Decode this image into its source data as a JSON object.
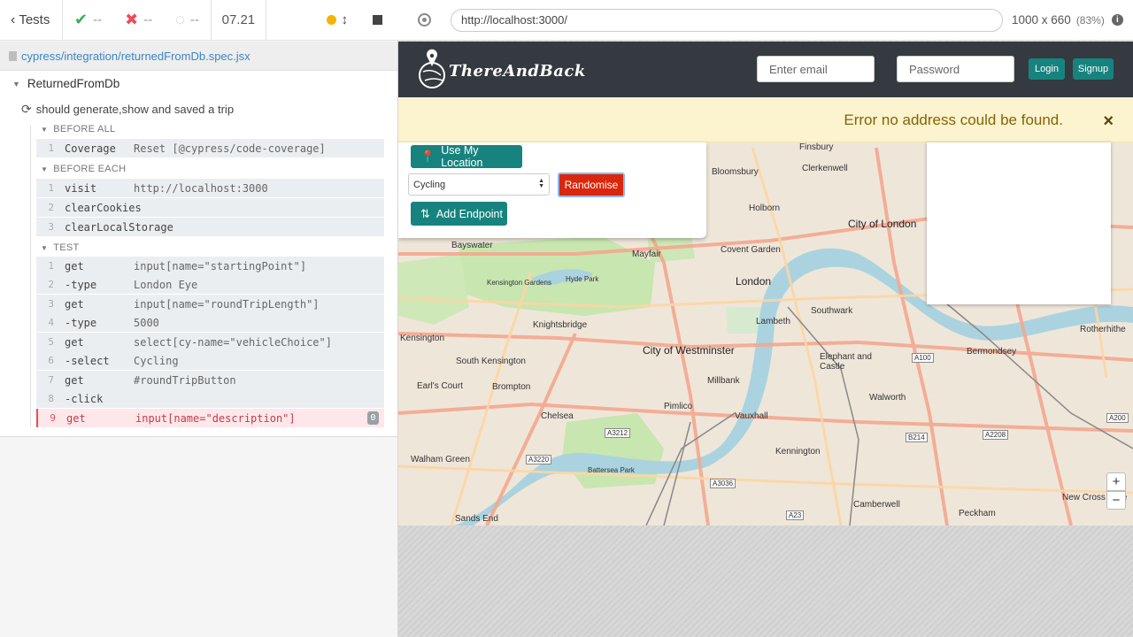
{
  "runner": {
    "tests_label": "Tests",
    "passed": "--",
    "failed": "--",
    "pending": "--",
    "timer": "07.21",
    "spec_path": "cypress/integration/returnedFromDb.spec.jsx",
    "suite_title": "ReturnedFromDb",
    "test_title": "should generate,show and saved a trip",
    "hooks": {
      "before_all": {
        "label": "BEFORE ALL",
        "commands": [
          {
            "num": "1",
            "name": "Coverage",
            "arg": "Reset [@cypress/code-coverage]"
          }
        ]
      },
      "before_each": {
        "label": "BEFORE EACH",
        "commands": [
          {
            "num": "1",
            "name": "visit",
            "arg": "http://localhost:3000"
          },
          {
            "num": "2",
            "name": "clearCookies",
            "arg": ""
          },
          {
            "num": "3",
            "name": "clearLocalStorage",
            "arg": ""
          }
        ]
      },
      "test": {
        "label": "TEST",
        "commands": [
          {
            "num": "1",
            "name": "get",
            "arg": "input[name=\"startingPoint\"]"
          },
          {
            "num": "2",
            "name": "-type",
            "arg": "London Eye"
          },
          {
            "num": "3",
            "name": "get",
            "arg": "input[name=\"roundTripLength\"]"
          },
          {
            "num": "4",
            "name": "-type",
            "arg": "5000"
          },
          {
            "num": "5",
            "name": "get",
            "arg": "select[cy-name=\"vehicleChoice\"]"
          },
          {
            "num": "6",
            "name": "-select",
            "arg": "Cycling"
          },
          {
            "num": "7",
            "name": "get",
            "arg": "#roundTripButton"
          },
          {
            "num": "8",
            "name": "-click",
            "arg": ""
          },
          {
            "num": "9",
            "name": "get",
            "arg": "input[name=\"description\"]",
            "badge": "0"
          }
        ]
      }
    }
  },
  "browser": {
    "url": "http://localhost:3000/",
    "viewport_size": "1000 x 660",
    "viewport_zoom": "(83%)"
  },
  "app": {
    "brand": "ThereAndBack",
    "email_placeholder": "Enter email",
    "password_placeholder": "Password",
    "login_label": "Login",
    "signup_label": "Signup",
    "error_message": "Error no address could be found.",
    "close_symbol": "×",
    "use_location_label": "Use My Location",
    "vehicle_selected": "Cycling",
    "randomise_label": "Randomise",
    "add_endpoint_label": "Add Endpoint",
    "zoom_in": "+",
    "zoom_out": "−"
  },
  "map": {
    "labels": [
      "Finsbury",
      "Bloomsbury",
      "Clerkenwell",
      "Holborn",
      "City of London",
      "Bayswater",
      "Mayfair",
      "Covent Garden",
      "London",
      "Kensington Gardens",
      "Hyde Park",
      "Southwark",
      "Knightsbridge",
      "Lambeth",
      "Rotherhithe",
      "Kensington",
      "City of Westminster",
      "Elephant and Castle",
      "Bermondsey",
      "South Kensington",
      "Millbank",
      "Earl's Court",
      "Brompton",
      "Walworth",
      "Pimlico",
      "Chelsea",
      "Vauxhall",
      "Walham Green",
      "Kennington",
      "Battersea Park",
      "Camberwell",
      "Peckham",
      "New Cross Gate",
      "Sands End"
    ],
    "roads": [
      "A100",
      "A200",
      "A3212",
      "A3220",
      "A3036",
      "B214",
      "A2208",
      "A23"
    ]
  },
  "colors": {
    "pass": "#3cad5a",
    "fail": "#e94f5b",
    "teal": "#17837e",
    "randomise": "#d9260d",
    "navbar": "#343a40",
    "alert_bg": "#fcf3cf",
    "alert_text": "#856404"
  }
}
